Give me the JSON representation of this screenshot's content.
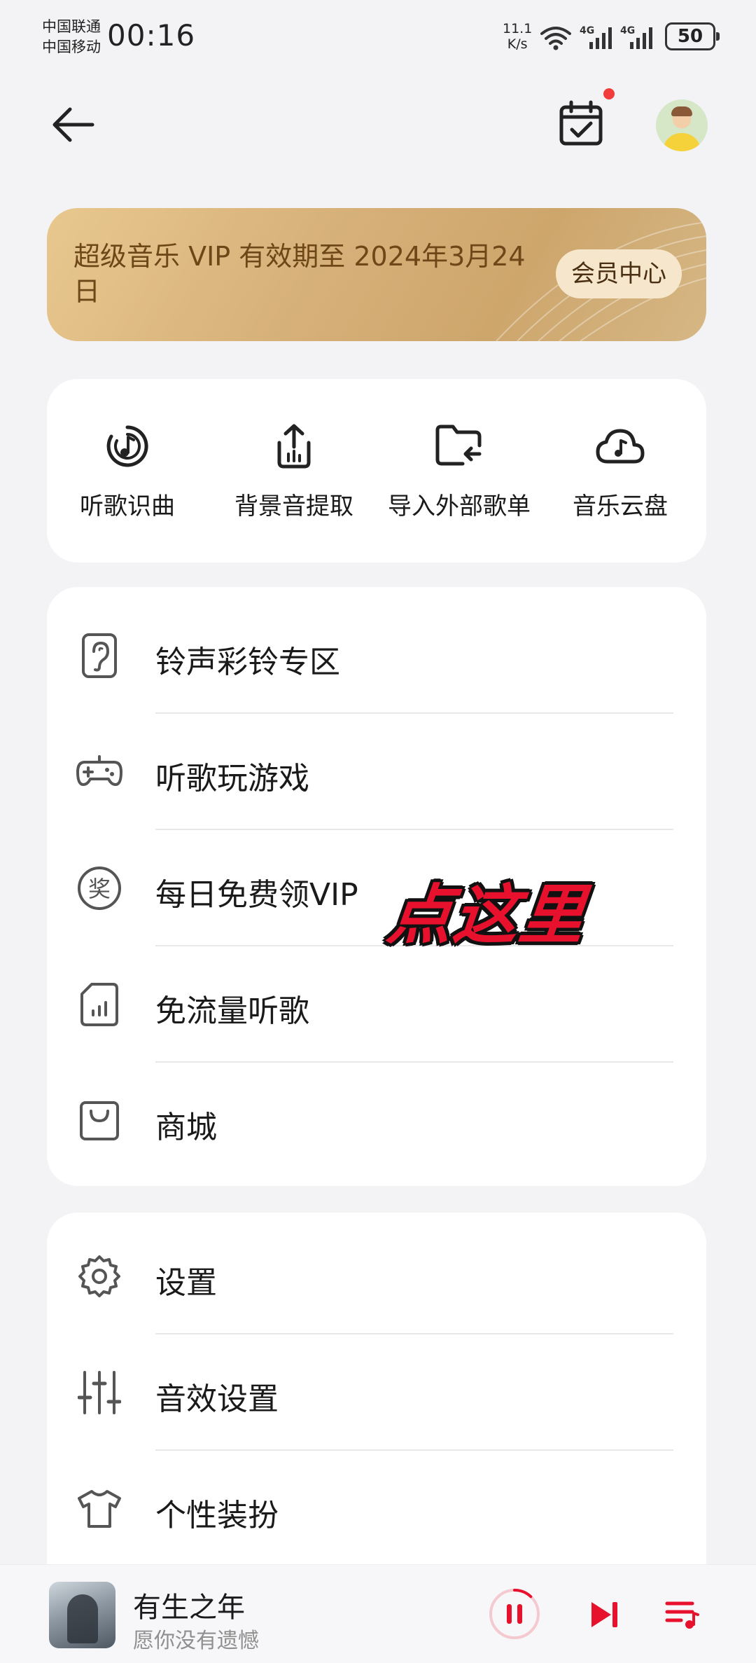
{
  "status_bar": {
    "carrier_1": "中国联通",
    "carrier_2": "中国移动",
    "time": "00:16",
    "speed_value": "11.1",
    "speed_unit": "K/s",
    "battery": "50",
    "icons": [
      "wifi-icon",
      "signal-4g-icon",
      "signal-4g-icon"
    ]
  },
  "header": {
    "icons": [
      "back-arrow-icon",
      "calendar-check-icon",
      "avatar"
    ]
  },
  "vip_banner": {
    "text": "超级音乐 VIP 有效期至 2024年3月24日",
    "button_label": "会员中心"
  },
  "quick_actions": [
    {
      "label": "听歌识曲",
      "icon": "music-recognize-icon"
    },
    {
      "label": "背景音提取",
      "icon": "audio-extract-icon"
    },
    {
      "label": "导入外部歌单",
      "icon": "folder-import-icon"
    },
    {
      "label": "音乐云盘",
      "icon": "cloud-music-icon"
    }
  ],
  "menu_1": [
    {
      "label": "铃声彩铃专区",
      "icon": "ringtone-icon"
    },
    {
      "label": "听歌玩游戏",
      "icon": "gamepad-icon"
    },
    {
      "label": "每日免费领VIP",
      "icon": "award-icon"
    },
    {
      "label": "免流量听歌",
      "icon": "sim-data-icon"
    },
    {
      "label": "商城",
      "icon": "shopping-bag-icon"
    }
  ],
  "menu_2": [
    {
      "label": "设置",
      "icon": "gear-icon"
    },
    {
      "label": "音效设置",
      "icon": "equalizer-icon"
    },
    {
      "label": "个性装扮",
      "icon": "tshirt-icon"
    }
  ],
  "overlay": {
    "click_here": "点这里"
  },
  "player": {
    "title": "有生之年",
    "subtitle": "愿你没有遗憾",
    "progress": 0.12,
    "accent": "#e8112d"
  }
}
